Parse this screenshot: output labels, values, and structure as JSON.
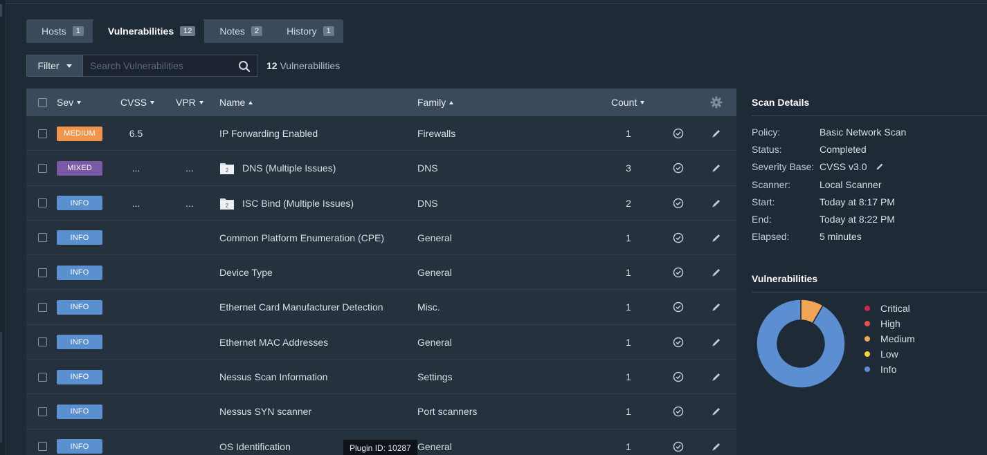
{
  "tabs": [
    {
      "label": "Hosts",
      "count": "1"
    },
    {
      "label": "Vulnerabilities",
      "count": "12"
    },
    {
      "label": "Notes",
      "count": "2"
    },
    {
      "label": "History",
      "count": "1"
    }
  ],
  "filter": {
    "button_label": "Filter",
    "search_placeholder": "Search Vulnerabilities",
    "result_count": "12",
    "result_label": "Vulnerabilities"
  },
  "table": {
    "headers": {
      "sev": "Sev",
      "cvss": "CVSS",
      "vpr": "VPR",
      "name": "Name",
      "family": "Family",
      "count": "Count"
    },
    "rows": [
      {
        "severity": "MEDIUM",
        "severity_color": "#f0954b",
        "cvss": "6.5",
        "vpr": "",
        "folder": false,
        "folder_count": "",
        "name": "IP Forwarding Enabled",
        "family": "Firewalls",
        "count": "1"
      },
      {
        "severity": "MIXED",
        "severity_color": "#7a5aa6",
        "cvss": "...",
        "vpr": "...",
        "folder": true,
        "folder_count": "2",
        "name": "DNS (Multiple Issues)",
        "family": "DNS",
        "count": "3"
      },
      {
        "severity": "INFO",
        "severity_color": "#5a8fd0",
        "cvss": "...",
        "vpr": "...",
        "folder": true,
        "folder_count": "2",
        "name": "ISC Bind (Multiple Issues)",
        "family": "DNS",
        "count": "2"
      },
      {
        "severity": "INFO",
        "severity_color": "#5a8fd0",
        "cvss": "",
        "vpr": "",
        "folder": false,
        "folder_count": "",
        "name": "Common Platform Enumeration (CPE)",
        "family": "General",
        "count": "1"
      },
      {
        "severity": "INFO",
        "severity_color": "#5a8fd0",
        "cvss": "",
        "vpr": "",
        "folder": false,
        "folder_count": "",
        "name": "Device Type",
        "family": "General",
        "count": "1"
      },
      {
        "severity": "INFO",
        "severity_color": "#5a8fd0",
        "cvss": "",
        "vpr": "",
        "folder": false,
        "folder_count": "",
        "name": "Ethernet Card Manufacturer Detection",
        "family": "Misc.",
        "count": "1"
      },
      {
        "severity": "INFO",
        "severity_color": "#5a8fd0",
        "cvss": "",
        "vpr": "",
        "folder": false,
        "folder_count": "",
        "name": "Ethernet MAC Addresses",
        "family": "General",
        "count": "1"
      },
      {
        "severity": "INFO",
        "severity_color": "#5a8fd0",
        "cvss": "",
        "vpr": "",
        "folder": false,
        "folder_count": "",
        "name": "Nessus Scan Information",
        "family": "Settings",
        "count": "1"
      },
      {
        "severity": "INFO",
        "severity_color": "#5a8fd0",
        "cvss": "",
        "vpr": "",
        "folder": false,
        "folder_count": "",
        "name": "Nessus SYN scanner",
        "family": "Port scanners",
        "count": "1"
      },
      {
        "severity": "INFO",
        "severity_color": "#5a8fd0",
        "cvss": "",
        "vpr": "",
        "folder": false,
        "folder_count": "",
        "name": "OS Identification",
        "family": "General",
        "count": "1"
      }
    ]
  },
  "tooltip": "Plugin ID: 10287",
  "scan_details": {
    "title": "Scan Details",
    "items": [
      {
        "key": "Policy:",
        "value": "Basic Network Scan"
      },
      {
        "key": "Status:",
        "value": "Completed"
      },
      {
        "key": "Severity Base:",
        "value": "CVSS v3.0"
      },
      {
        "key": "Scanner:",
        "value": "Local Scanner"
      },
      {
        "key": "Start:",
        "value": "Today at 8:17 PM"
      },
      {
        "key": "End:",
        "value": "Today at 8:22 PM"
      },
      {
        "key": "Elapsed:",
        "value": "5 minutes"
      }
    ]
  },
  "vulnerabilities_panel": {
    "title": "Vulnerabilities",
    "legend": [
      {
        "label": "Critical",
        "color": "#d2244a"
      },
      {
        "label": "High",
        "color": "#ec4d4d"
      },
      {
        "label": "Medium",
        "color": "#f0a456"
      },
      {
        "label": "Low",
        "color": "#f5d03b"
      },
      {
        "label": "Info",
        "color": "#5b8fd1"
      }
    ],
    "donut": {
      "medium": 1,
      "info": 11
    }
  }
}
